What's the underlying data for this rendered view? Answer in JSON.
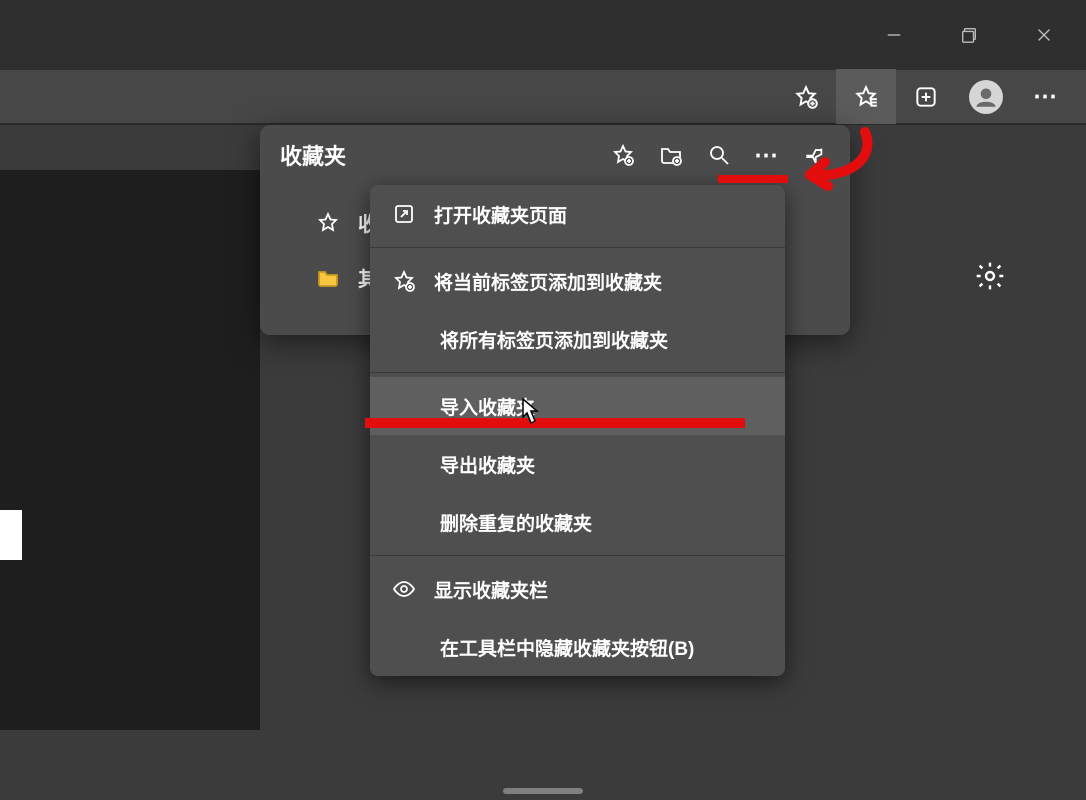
{
  "window": {
    "controls": {
      "minimize": "—",
      "maximize": "❐",
      "close": "✕"
    }
  },
  "toolbar": {
    "more": "⋯"
  },
  "settings_icon": "gear",
  "favorites_panel": {
    "title": "收藏夹",
    "header_more": "⋯",
    "rows": [
      {
        "type": "star",
        "label_partial": "收"
      },
      {
        "type": "folder",
        "label_partial": "其"
      }
    ]
  },
  "context_menu": {
    "items": [
      {
        "icon": "open-new",
        "label": "打开收藏夹页面"
      },
      {
        "icon": "star-add",
        "label": "将当前标签页添加到收藏夹"
      },
      {
        "label": "将所有标签页添加到收藏夹"
      },
      {
        "label": "导入收藏夹",
        "hover": true
      },
      {
        "label": "导出收藏夹"
      },
      {
        "label": "删除重复的收藏夹"
      },
      {
        "icon": "eye",
        "label": "显示收藏夹栏"
      },
      {
        "label": "在工具栏中隐藏收藏夹按钮(B)"
      }
    ]
  }
}
